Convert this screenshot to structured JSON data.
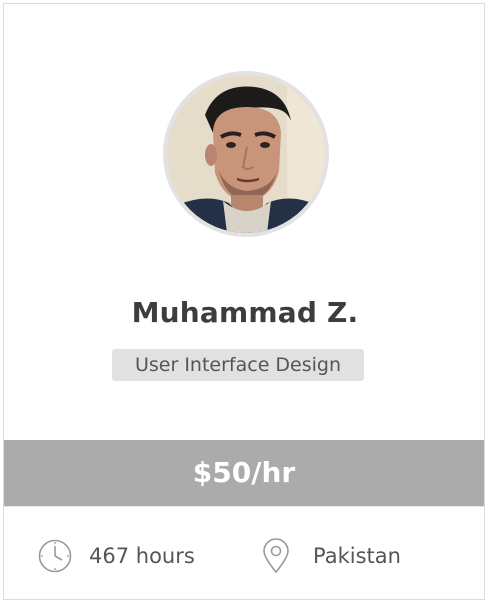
{
  "freelancer": {
    "name": "Muhammad Z.",
    "skill": "User Interface Design",
    "rate": "$50/hr",
    "hours": "467 hours",
    "location": "Pakistan",
    "avatar_icon": "profile-photo"
  },
  "colors": {
    "rate_bar": "#ababab",
    "skill_tag": "#e1e1e1",
    "avatar_ring": "#e2e2e2",
    "text_dark": "#3d3d3d",
    "icon_gray": "#9a9a9a"
  }
}
